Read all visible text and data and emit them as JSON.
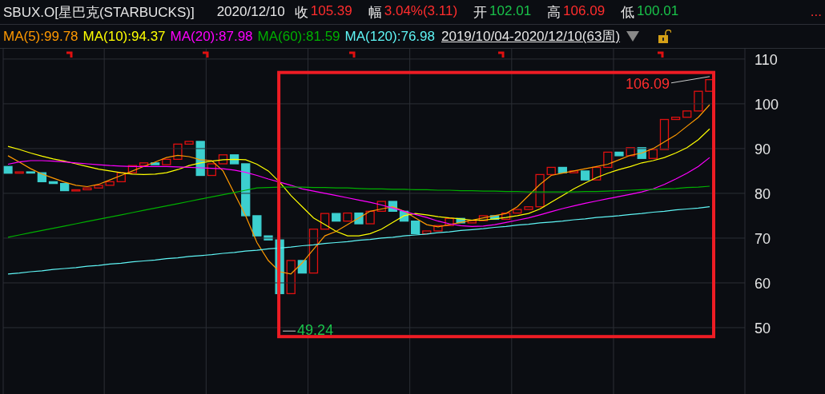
{
  "quote": {
    "symbol": "SBUX.O[星巴克(STARBUCKS)]",
    "date": "2020/12/10",
    "fields": [
      {
        "label": "收",
        "value": "105.39",
        "color": "#ff2d2d"
      },
      {
        "label": "幅",
        "value": "3.04%(3.11)",
        "color": "#ff2d2d"
      },
      {
        "label": "开",
        "value": "102.01",
        "color": "#19c24a"
      },
      {
        "label": "高",
        "value": "106.09",
        "color": "#ff2d2d"
      },
      {
        "label": "低",
        "value": "100.01",
        "color": "#19c24a"
      }
    ],
    "more": "..."
  },
  "indicators": [
    {
      "text": "MA(5):99.78",
      "color": "#ff9900"
    },
    {
      "text": "MA(10):94.37",
      "color": "#ffff00"
    },
    {
      "text": "MA(20):87.98",
      "color": "#ff00ff"
    },
    {
      "text": "MA(60):81.59",
      "color": "#00b000"
    },
    {
      "text": "MA(120):76.98",
      "color": "#5ff5f5"
    }
  ],
  "range": {
    "label": "2019/10/04-2020/12/10(63周)",
    "locked": false
  },
  "chart_data": {
    "type": "line",
    "grid": true,
    "ylim": [
      35,
      112.3
    ],
    "yticks": [
      50,
      60,
      70,
      80,
      90,
      100,
      110
    ],
    "series": [
      {
        "color": "#ff9900",
        "values": [
          88.4,
          87,
          85.5,
          84.3,
          83.4,
          82.5,
          81.8,
          81.5,
          82,
          83,
          84,
          85,
          86,
          87,
          88,
          88.5,
          88.2,
          87.5,
          87.3,
          85,
          80,
          75,
          69,
          65,
          62.5,
          62,
          64.5,
          67.5,
          70.5,
          71.5,
          73,
          74.5,
          76,
          76.5,
          77,
          76,
          74.5,
          73,
          72.5,
          73,
          73.5,
          74,
          74.5,
          75,
          75.5,
          77,
          79.5,
          82,
          84,
          84.5,
          85,
          85.5,
          86,
          86.5,
          87.5,
          88.5,
          89,
          90,
          91.5,
          93,
          95,
          97,
          99.8
        ]
      },
      {
        "color": "#ffff00",
        "values": [
          90.5,
          89.8,
          89,
          88.3,
          87.7,
          87.2,
          86.6,
          86,
          85.4,
          85,
          84.6,
          84.3,
          84.2,
          84.3,
          84.6,
          85.3,
          86.2,
          86.8,
          87.2,
          87.5,
          87.6,
          87.5,
          86.5,
          85,
          82.5,
          79.5,
          77,
          74.5,
          73,
          71.5,
          70.5,
          70.5,
          71,
          72,
          73.5,
          75,
          75.5,
          75.2,
          74.8,
          74.5,
          74.3,
          74,
          74,
          74.3,
          74.6,
          75,
          75.5,
          76.5,
          78,
          79.5,
          81,
          82.3,
          83.5,
          84.5,
          85.3,
          86,
          86.8,
          87.3,
          88,
          89,
          90.2,
          92,
          94.4
        ]
      },
      {
        "color": "#ff00ff",
        "values": [
          86.5,
          87,
          87.3,
          87.3,
          87.2,
          87,
          86.8,
          86.6,
          86.4,
          86.2,
          86.1,
          86,
          86,
          86,
          86,
          85.9,
          85.8,
          85.7,
          85.6,
          85.5,
          85.2,
          84.7,
          84,
          83.2,
          82.5,
          81.8,
          81,
          80.5,
          80,
          79.5,
          79,
          78.5,
          78,
          77.4,
          76.7,
          76,
          75.3,
          74.6,
          73.8,
          73.2,
          72.8,
          72.6,
          72.7,
          73,
          73.5,
          74,
          74.5,
          75.2,
          75.9,
          76.6,
          77.2,
          77.8,
          78.3,
          78.8,
          79.3,
          79.8,
          80.3,
          81,
          82,
          83.2,
          84.5,
          86,
          88
        ]
      },
      {
        "color": "#00b000",
        "values": [
          70.2,
          70.7,
          71.2,
          71.7,
          72.2,
          72.7,
          73.2,
          73.7,
          74.2,
          74.7,
          75.2,
          75.7,
          76.2,
          76.7,
          77.2,
          77.7,
          78.2,
          78.7,
          79.2,
          79.7,
          80.2,
          80.7,
          81.2,
          81.3,
          81.4,
          81.4,
          81.4,
          81.3,
          81.3,
          81.2,
          81.2,
          81.1,
          81,
          81,
          80.9,
          80.9,
          80.8,
          80.8,
          80.7,
          80.7,
          80.6,
          80.6,
          80.5,
          80.5,
          80.4,
          80.4,
          80.3,
          80.3,
          80.3,
          80.3,
          80.3,
          80.4,
          80.4,
          80.5,
          80.6,
          80.7,
          80.8,
          80.9,
          81,
          81.1,
          81.3,
          81.4,
          81.6
        ]
      },
      {
        "color": "#5ff5f5",
        "values": [
          62,
          62.2,
          62.5,
          62.7,
          63,
          63.2,
          63.4,
          63.7,
          63.9,
          64.2,
          64.4,
          64.7,
          64.9,
          65.1,
          65.4,
          65.6,
          65.9,
          66.1,
          66.3,
          66.6,
          66.8,
          67.1,
          67.3,
          67.6,
          67.8,
          68,
          68.3,
          68.5,
          68.8,
          69,
          69.2,
          69.5,
          69.7,
          70,
          70.2,
          70.5,
          70.7,
          70.9,
          71.2,
          71.4,
          71.7,
          71.9,
          72.1,
          72.4,
          72.6,
          72.9,
          73.1,
          73.4,
          73.6,
          73.8,
          74.1,
          74.3,
          74.6,
          74.8,
          75,
          75.3,
          75.5,
          75.8,
          76,
          76.3,
          76.5,
          76.7,
          77
        ]
      }
    ],
    "annotations": [
      {
        "text": "106.09"
      },
      {
        "text": "49.24"
      }
    ]
  },
  "highlight_frame": {
    "color": "#ee1c24"
  }
}
